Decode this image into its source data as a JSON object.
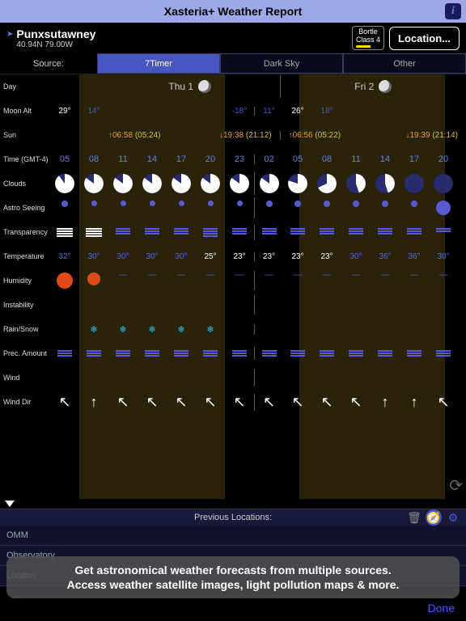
{
  "titlebar": {
    "title": "Xasteria+ Weather Report"
  },
  "location": {
    "name": "Punxsutawney",
    "coords": "40.94N 79.00W"
  },
  "bortle": {
    "label": "Bortle",
    "class": "Class 4"
  },
  "location_btn": "Location...",
  "tabs": {
    "source": "Source:",
    "t1": "7Timer",
    "t2": "Dark Sky",
    "t3": "Other"
  },
  "rows": {
    "day": "Day",
    "moonalt": "Moon Alt",
    "sun": "Sun",
    "time": "Time (GMT-4)",
    "clouds": "Clouds",
    "seeing": "Astro Seeing",
    "trans": "Transparency",
    "temp": "Temperature",
    "hum": "Humidity",
    "instab": "Instability",
    "rain": "Rain/Snow",
    "prec": "Prec. Amount",
    "wind": "Wind",
    "winddir": "Wind Dir"
  },
  "days": {
    "d1": "Thu 1",
    "d2": "Fri 2"
  },
  "moonalt": [
    "29°",
    "14°",
    "",
    "",
    "",
    "",
    "-18°",
    "11°",
    "26°",
    "18°",
    "",
    "",
    "",
    ""
  ],
  "sun": {
    "d1_rise": "↑06:58 ",
    "d1_rise_p": "(05:24)",
    "d1_set": "↓19:38 ",
    "d1_set_p": "(21:12)",
    "d2_rise": "↑06:56 ",
    "d2_rise_p": "(05:22)",
    "d2_set": "↓19:39 ",
    "d2_set_p": "(21:14)"
  },
  "times": [
    "05",
    "08",
    "11",
    "14",
    "17",
    "20",
    "23",
    "02",
    "05",
    "08",
    "11",
    "14",
    "17",
    "20"
  ],
  "temps": [
    "32°",
    "30°",
    "30°",
    "30°",
    "30°",
    "25°",
    "23°",
    "23°",
    "23°",
    "23°",
    "30°",
    "36°",
    "36°",
    "30°"
  ],
  "prev": {
    "title": "Previous Locations:",
    "items": [
      "OMM",
      "Observatory",
      "London"
    ]
  },
  "caption": {
    "l1": "Get astronomical weather forecasts from multiple sources.",
    "l2": "Access weather satellite images, light pollution maps & more."
  },
  "done": "Done"
}
